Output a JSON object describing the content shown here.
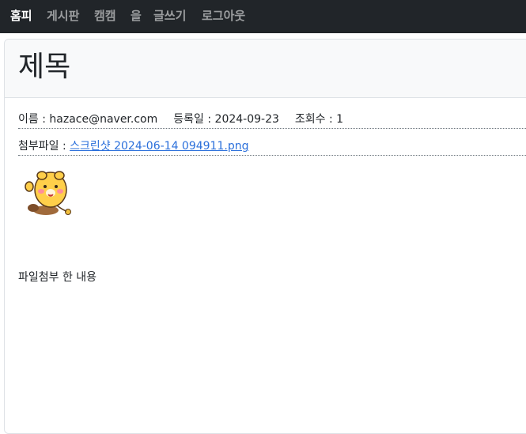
{
  "nav": {
    "items": [
      "홈피",
      "게시판",
      "캠캠",
      "을",
      "글쓰기",
      "로그아웃"
    ]
  },
  "post": {
    "title": "제목",
    "name_label": "이름 : ",
    "name_value": "hazace@naver.com",
    "date_label": "등록일 : ",
    "date_value": "2024-09-23",
    "views_label": "조회수 : ",
    "views_value": "1",
    "attachment_label": "첨부파일 : ",
    "attachment_name": "스크린샷 2024-06-14 094911.png",
    "content": "파일첨부 한 내용"
  },
  "colors": {
    "navbar_bg": "#212529",
    "link": "#2a6fdb"
  }
}
